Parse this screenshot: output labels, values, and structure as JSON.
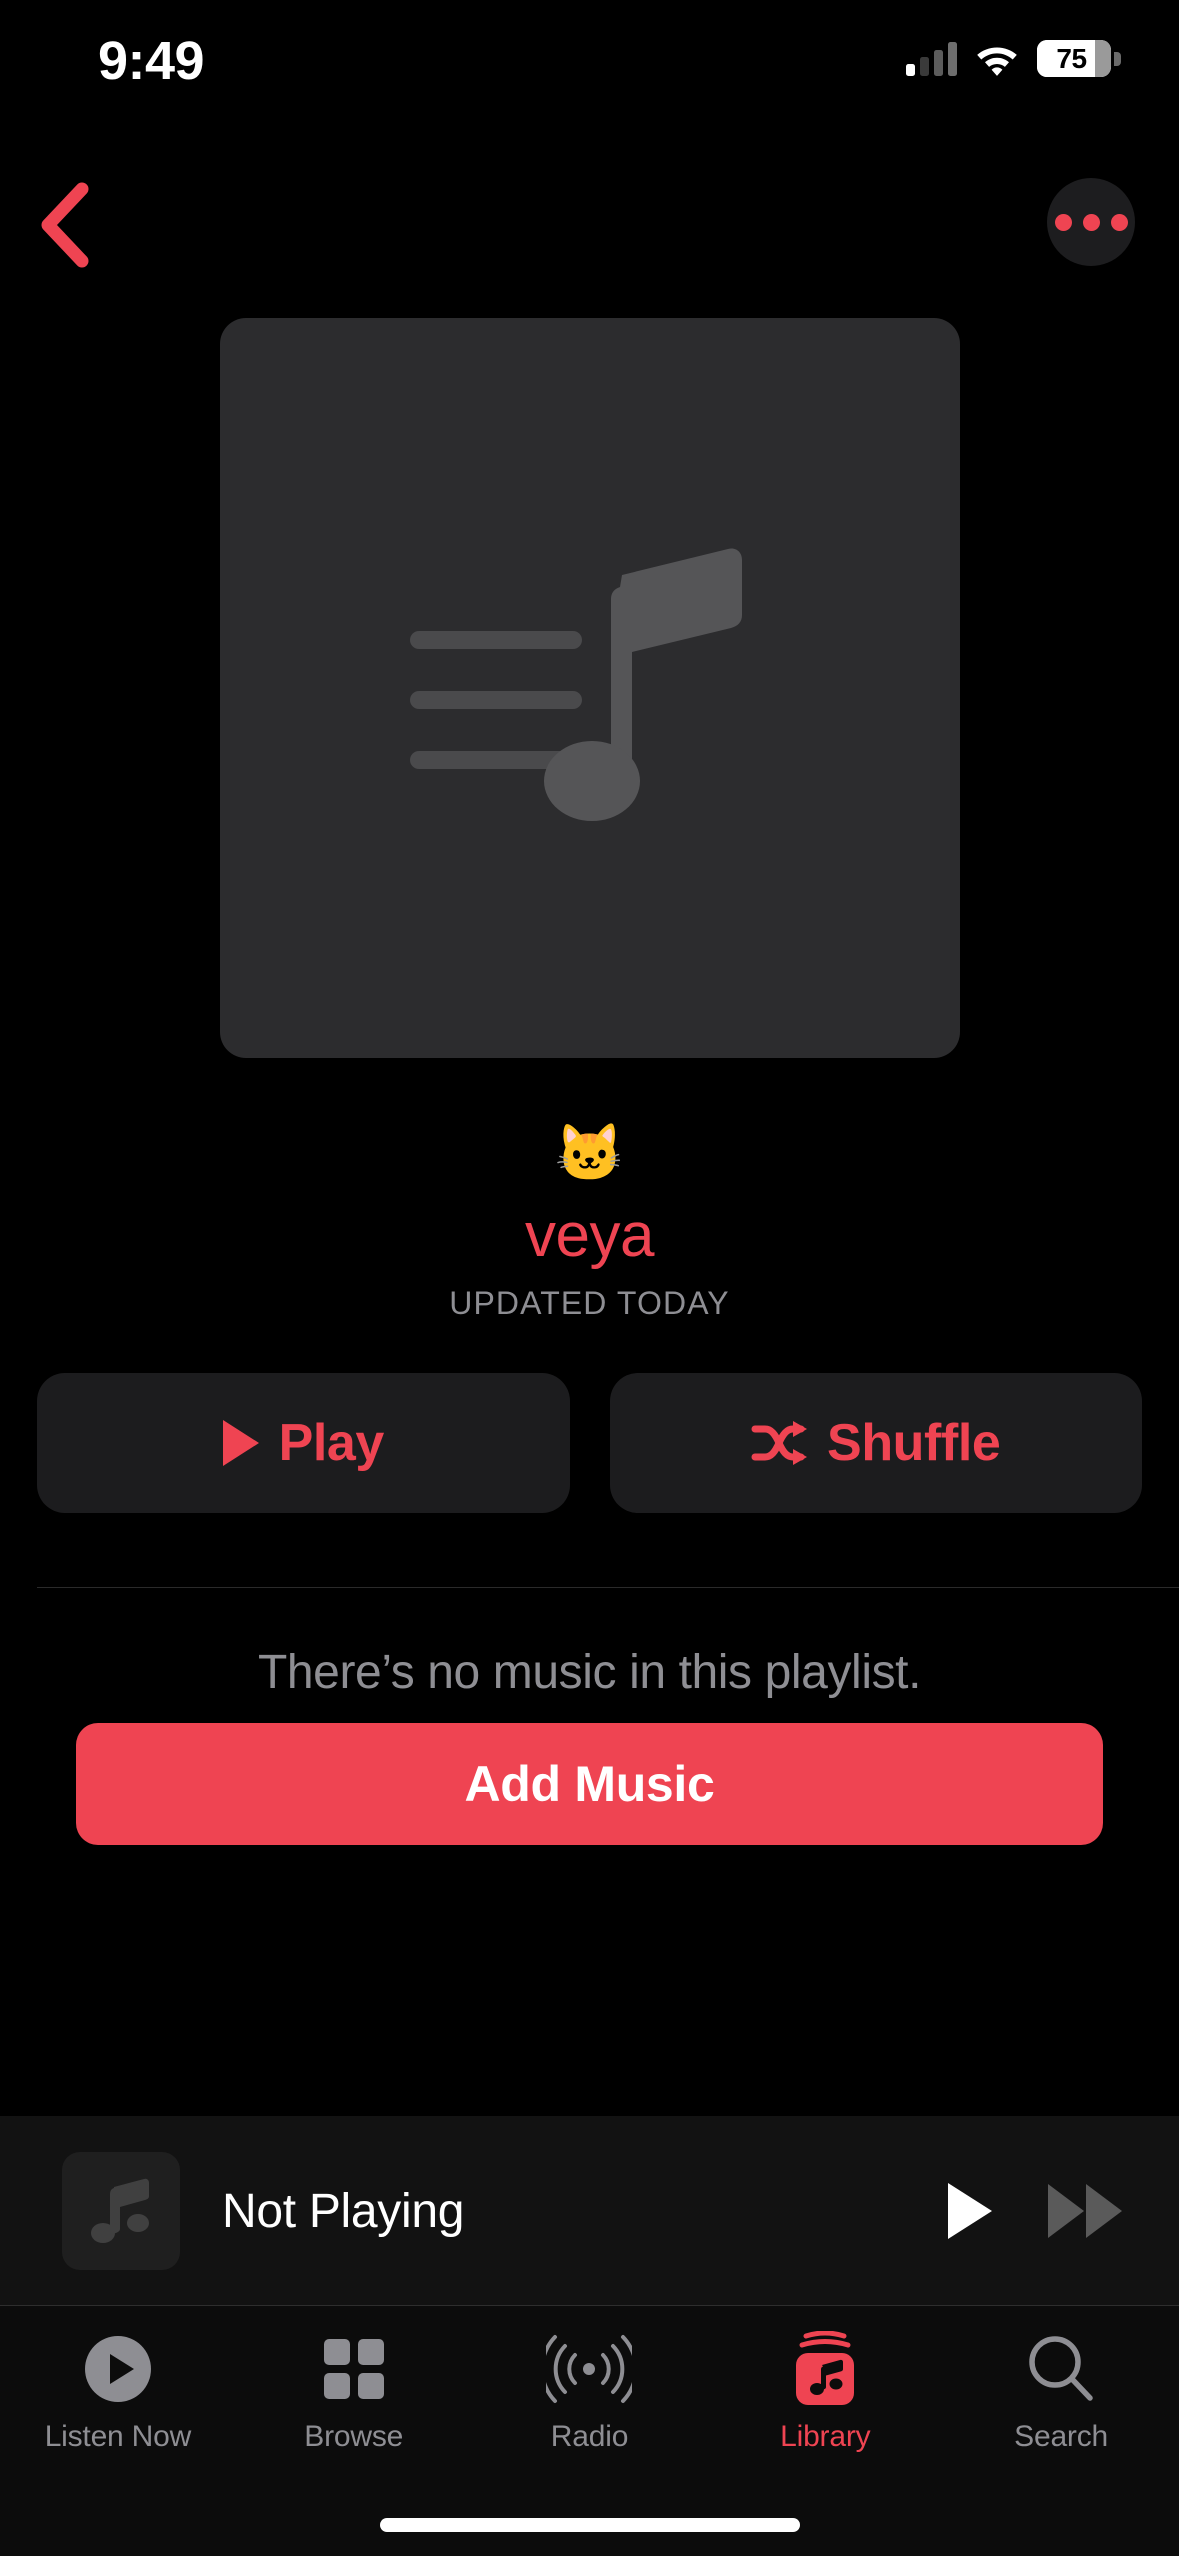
{
  "status_bar": {
    "time": "9:49",
    "battery_percent": "75",
    "cellular_icon": "cellular-bars-icon",
    "wifi_icon": "wifi-icon",
    "battery_icon": "battery-icon"
  },
  "nav_bar": {
    "back_icon": "chevron-left-icon",
    "more_icon": "ellipsis-circle-icon",
    "accent_color": "#EF4452"
  },
  "artwork": {
    "placeholder_icon": "playlist-music-note-icon",
    "background_color": "#2C2C2E",
    "icon_color": "#4A4A4C"
  },
  "header": {
    "emoji": "🐱",
    "title": "veya",
    "subtitle": "UPDATED TODAY",
    "title_color": "#EF4452",
    "subtitle_color": "#8E8E93"
  },
  "actions": {
    "play_label": "Play",
    "play_icon": "play-triangle-icon",
    "shuffle_label": "Shuffle",
    "shuffle_icon": "shuffle-arrows-icon",
    "button_background": "#1C1C1E"
  },
  "empty_state": {
    "message": "There’s no music in this playlist.",
    "add_music_label": "Add Music",
    "add_music_color": "#EF4452"
  },
  "mini_player": {
    "title": "Not Playing",
    "artwork_icon": "music-note-icon",
    "play_icon": "play-icon",
    "forward_icon": "fast-forward-icon",
    "background_color": "#121212"
  },
  "tab_bar": {
    "items": [
      {
        "label": "Listen Now",
        "icon": "play-circle-icon",
        "active": false
      },
      {
        "label": "Browse",
        "icon": "grid-squares-icon",
        "active": false
      },
      {
        "label": "Radio",
        "icon": "radio-waves-icon",
        "active": false
      },
      {
        "label": "Library",
        "icon": "library-books-icon",
        "active": true
      },
      {
        "label": "Search",
        "icon": "magnifier-icon",
        "active": false
      }
    ],
    "active_color": "#EF4452",
    "inactive_color": "#8E8E93"
  }
}
